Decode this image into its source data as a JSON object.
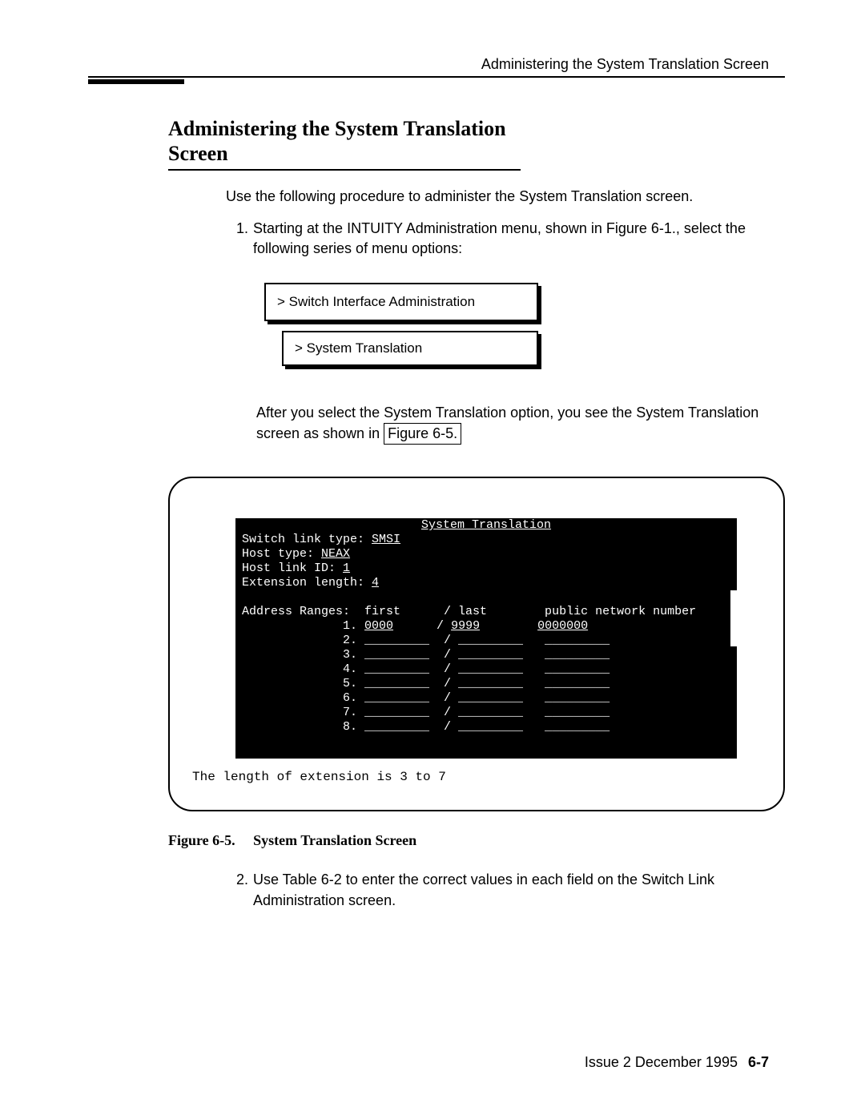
{
  "running_header": "Administering the System Translation Screen",
  "section_title": "Administering the System Translation Screen",
  "intro": "Use the following procedure to administer the System Translation screen.",
  "step1_num": "1.",
  "step1_text": "Starting at the INTUITY Administration menu, shown in Figure 6-1., select the following series of menu options:",
  "menu1": "> Switch Interface Administration",
  "menu2": "> System Translation",
  "after_menu_a": "After you select the System Translation option, you see the System Translation screen as shown in ",
  "after_menu_link": "Figure 6-5.",
  "terminal": {
    "title": "System Translation",
    "switch_link_label": "Switch link type: ",
    "switch_link_value": "SMSI",
    "host_type_label": "Host type: ",
    "host_type_value": "NEAX",
    "host_link_label": "Host link ID: ",
    "host_link_value": "1",
    "ext_len_label": "Extension length: ",
    "ext_len_value": "4",
    "addr_header": "Address Ranges:  first      / last        public network number",
    "row1": "              1. ",
    "row1_first": "0000",
    "row1_sep": "      / ",
    "row1_last": "9999",
    "row1_pad": "        ",
    "row1_pub": "0000000",
    "row2": "              2. _________  / _________   _________",
    "row3": "              3. _________  / _________   _________",
    "row4": "              4. _________  / _________   _________",
    "row5": "              5. _________  / _________   _________",
    "row6": "              6. _________  / _________   _________",
    "row7": "              7. _________  / _________   _________",
    "row8": "              8. _________  / _________   _________",
    "footer_msg": "The length of extension is 3 to 7"
  },
  "figure_num": "Figure 6-5.",
  "figure_title": "System Translation Screen",
  "step2_num": "2.",
  "step2_text": "Use Table 6-2 to enter the correct values in each field on the Switch Link Administration screen.",
  "issue": "Issue 2   December 1995",
  "page_num": "6-7"
}
